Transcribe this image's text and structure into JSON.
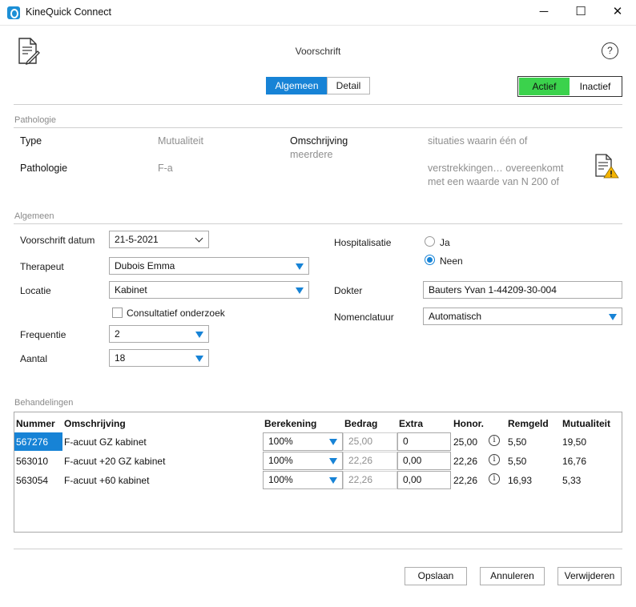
{
  "window": {
    "title": "KineQuick Connect",
    "minimize": "─",
    "maximize": "☐",
    "close": "✕"
  },
  "header": {
    "title": "Voorschrift",
    "help": "?"
  },
  "tabs": [
    {
      "label": "Algemeen"
    },
    {
      "label": "Detail"
    }
  ],
  "status": {
    "active_label": "Actief",
    "inactive_label": "Inactief",
    "active_color": "#3bd24c"
  },
  "pathologie": {
    "section_title": "Pathologie",
    "type_label": "Type",
    "type_value": "Mutualiteit",
    "pathologie_label": "Pathologie",
    "pathologie_value": "F-a",
    "omschrijving_label": "Omschrijving",
    "omschrijving_line1": "situaties waarin één of",
    "omschrijving_line2": "meerdere",
    "omschrijving_line3": "verstrekkingen… overeenkomt",
    "omschrijving_line4": "met een waarde van N 200 of"
  },
  "algemeen": {
    "section_title": "Algemeen",
    "datum_label": "Voorschrift datum",
    "datum_value": "21-5-2021",
    "therapeut_label": "Therapeut",
    "therapeut_value": "Dubois Emma",
    "locatie_label": "Locatie",
    "locatie_value": "Kabinet",
    "consultatief_label": "Consultatief onderzoek",
    "frequentie_label": "Frequentie",
    "frequentie_value": "2",
    "aantal_label": "Aantal",
    "aantal_value": "18",
    "hospitalisatie_label": "Hospitalisatie",
    "ja_label": "Ja",
    "neen_label": "Neen",
    "dokter_label": "Dokter",
    "dokter_value": "Bauters Yvan  1-44209-30-004",
    "nomenclatuur_label": "Nomenclatuur",
    "nomenclatuur_value": "Automatisch"
  },
  "behandelingen": {
    "section_title": "Behandelingen",
    "columns": [
      "Nummer",
      "Omschrijving",
      "Berekening",
      "Bedrag",
      "Extra",
      "Honor.",
      "Remgeld",
      "Mutualiteit"
    ],
    "rows": [
      {
        "nummer": "567276",
        "omschrijving": "F-acuut  GZ kabinet",
        "berekening": "100%",
        "bedrag": "25,00",
        "extra": "0",
        "honor": "25,00",
        "remgeld": "5,50",
        "mutualiteit": "19,50"
      },
      {
        "nummer": "563010",
        "omschrijving": "F-acuut +20 GZ kabinet",
        "berekening": "100%",
        "bedrag": "22,26",
        "extra": "0,00",
        "honor": "22,26",
        "remgeld": "5,50",
        "mutualiteit": "16,76"
      },
      {
        "nummer": "563054",
        "omschrijving": "F-acuut +60 kabinet",
        "berekening": "100%",
        "bedrag": "22,26",
        "extra": "0,00",
        "honor": "22,26",
        "remgeld": "16,93",
        "mutualiteit": "5,33"
      }
    ],
    "info_symbol": "i"
  },
  "footer": {
    "save_label": "Opslaan",
    "cancel_label": "Annuleren",
    "delete_label": "Verwijderen"
  },
  "accent_color": "#1783d6"
}
